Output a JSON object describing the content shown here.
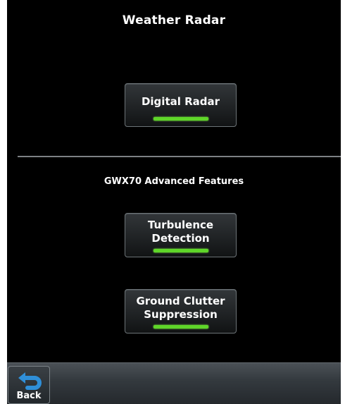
{
  "header": {
    "title": "Weather Radar"
  },
  "buttons": {
    "digital_radar": {
      "label": "Digital Radar",
      "active": true
    },
    "turbulence": {
      "line1": "Turbulence",
      "line2": "Detection",
      "active": true
    },
    "ground_clutter": {
      "line1": "Ground Clutter",
      "line2": "Suppression",
      "active": true
    }
  },
  "section": {
    "label": "GWX70 Advanced Features"
  },
  "footer": {
    "back_label": "Back"
  },
  "colors": {
    "background": "#000000",
    "status_on": "#5fd629",
    "icon_blue": "#2f8fd8"
  },
  "icons": {
    "back": "back-arrow-icon"
  }
}
